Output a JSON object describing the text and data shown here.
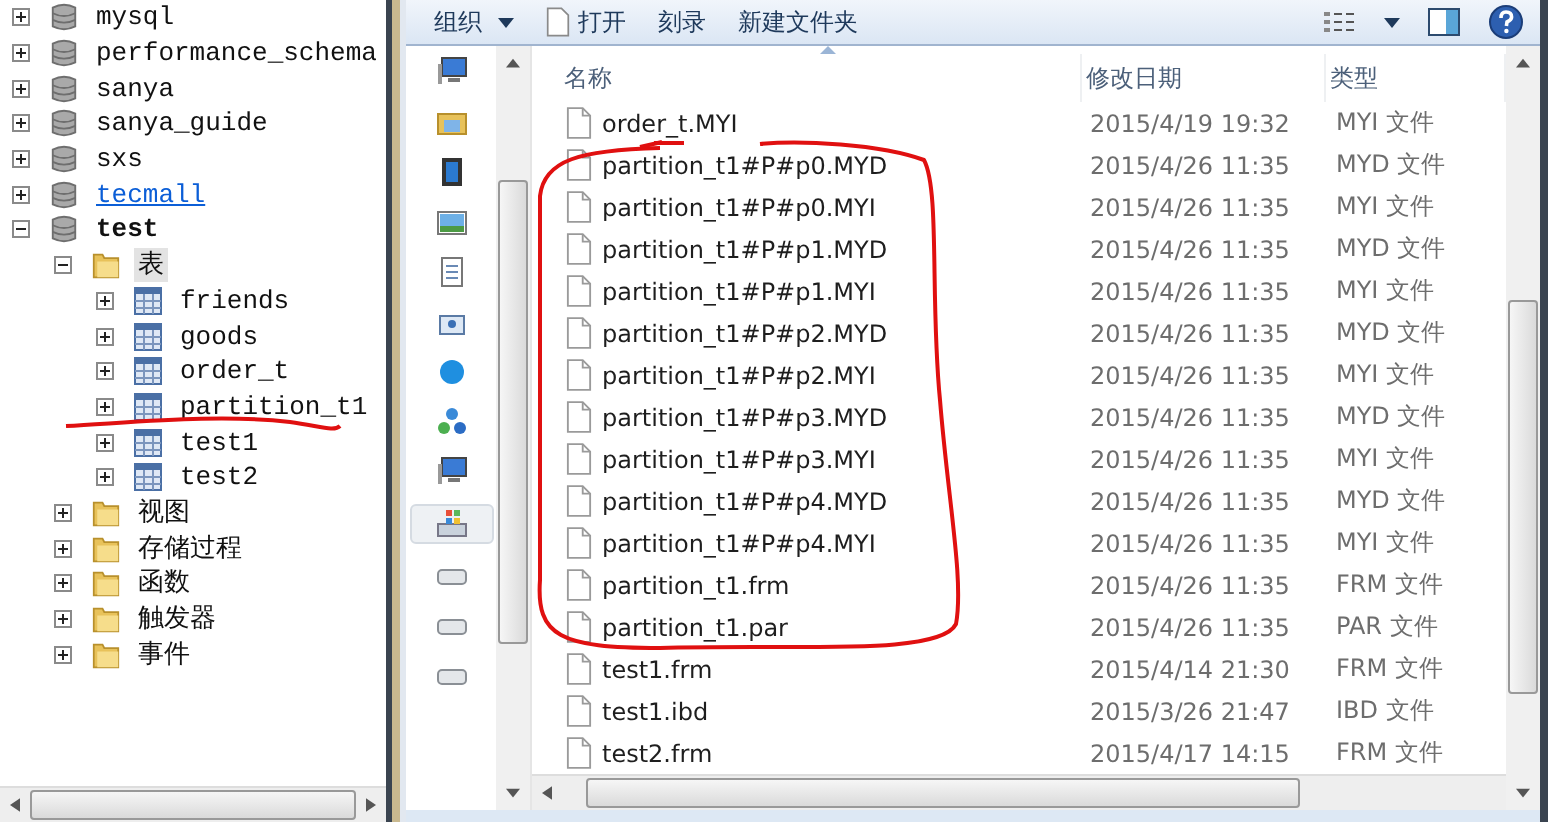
{
  "tree": {
    "items": [
      {
        "label": "mysql",
        "kind": "database",
        "expanded": false,
        "selected": false,
        "hovered": false,
        "active": false
      },
      {
        "label": "performance_schema",
        "kind": "database",
        "expanded": false,
        "selected": false,
        "hovered": false,
        "active": false
      },
      {
        "label": "sanya",
        "kind": "database",
        "expanded": false,
        "selected": false,
        "hovered": false,
        "active": false
      },
      {
        "label": "sanya_guide",
        "kind": "database",
        "expanded": false,
        "selected": false,
        "hovered": false,
        "active": false
      },
      {
        "label": "sxs",
        "kind": "database",
        "expanded": false,
        "selected": false,
        "hovered": false,
        "active": false
      },
      {
        "label": "tecmall",
        "kind": "database",
        "expanded": false,
        "selected": false,
        "hovered": true,
        "active": false
      },
      {
        "label": "test",
        "kind": "database",
        "expanded": true,
        "selected": false,
        "hovered": false,
        "active": true,
        "children": [
          {
            "label": "表",
            "kind": "folder",
            "expanded": true,
            "selected": true,
            "hovered": false,
            "active": false,
            "children": [
              {
                "label": "friends",
                "kind": "table",
                "expanded": false,
                "selected": false,
                "hovered": false,
                "active": false
              },
              {
                "label": "goods",
                "kind": "table",
                "expanded": false,
                "selected": false,
                "hovered": false,
                "active": false
              },
              {
                "label": "order_t",
                "kind": "table",
                "expanded": false,
                "selected": false,
                "hovered": false,
                "active": false
              },
              {
                "label": "partition_t1",
                "kind": "table",
                "expanded": false,
                "selected": false,
                "hovered": false,
                "active": false
              },
              {
                "label": "test1",
                "kind": "table",
                "expanded": false,
                "selected": false,
                "hovered": false,
                "active": false
              },
              {
                "label": "test2",
                "kind": "table",
                "expanded": false,
                "selected": false,
                "hovered": false,
                "active": false
              }
            ]
          },
          {
            "label": "视图",
            "kind": "folder",
            "expanded": false,
            "selected": false,
            "hovered": false,
            "active": false
          },
          {
            "label": "存储过程",
            "kind": "folder",
            "expanded": false,
            "selected": false,
            "hovered": false,
            "active": false
          },
          {
            "label": "函数",
            "kind": "folder",
            "expanded": false,
            "selected": false,
            "hovered": false,
            "active": false
          },
          {
            "label": "触发器",
            "kind": "folder",
            "expanded": false,
            "selected": false,
            "hovered": false,
            "active": false
          },
          {
            "label": "事件",
            "kind": "folder",
            "expanded": false,
            "selected": false,
            "hovered": false,
            "active": false
          }
        ]
      }
    ]
  },
  "explorer": {
    "toolbar": {
      "buttons": [
        {
          "label": "组织",
          "kind": "menu"
        },
        {
          "label": "打开",
          "kind": "open"
        },
        {
          "label": "刻录",
          "kind": "plain"
        },
        {
          "label": "新建文件夹",
          "kind": "plain"
        }
      ]
    },
    "nav_pane": {
      "items": [
        {
          "kind": "computer",
          "selected": false
        },
        {
          "kind": "library",
          "selected": false
        },
        {
          "kind": "video",
          "selected": false
        },
        {
          "kind": "picture",
          "selected": false
        },
        {
          "kind": "document",
          "selected": false
        },
        {
          "kind": "music",
          "selected": false
        },
        {
          "kind": "homegroup",
          "selected": false
        },
        {
          "kind": "network",
          "selected": false
        },
        {
          "kind": "computer",
          "selected": false
        },
        {
          "kind": "windows-drive",
          "selected": true
        },
        {
          "kind": "drive",
          "selected": false
        },
        {
          "kind": "drive",
          "selected": false
        },
        {
          "kind": "drive",
          "selected": false
        }
      ]
    },
    "file_list": {
      "columns": [
        {
          "label": "名称",
          "sorted": true
        },
        {
          "label": "修改日期",
          "sorted": false
        },
        {
          "label": "类型",
          "sorted": false
        }
      ],
      "rows": [
        {
          "name": "order_t.MYI",
          "modified": "2015/4/19 19:32",
          "type": "MYI 文件"
        },
        {
          "name": "partition_t1#P#p0.MYD",
          "modified": "2015/4/26 11:35",
          "type": "MYD 文件"
        },
        {
          "name": "partition_t1#P#p0.MYI",
          "modified": "2015/4/26 11:35",
          "type": "MYI 文件"
        },
        {
          "name": "partition_t1#P#p1.MYD",
          "modified": "2015/4/26 11:35",
          "type": "MYD 文件"
        },
        {
          "name": "partition_t1#P#p1.MYI",
          "modified": "2015/4/26 11:35",
          "type": "MYI 文件"
        },
        {
          "name": "partition_t1#P#p2.MYD",
          "modified": "2015/4/26 11:35",
          "type": "MYD 文件"
        },
        {
          "name": "partition_t1#P#p2.MYI",
          "modified": "2015/4/26 11:35",
          "type": "MYI 文件"
        },
        {
          "name": "partition_t1#P#p3.MYD",
          "modified": "2015/4/26 11:35",
          "type": "MYD 文件"
        },
        {
          "name": "partition_t1#P#p3.MYI",
          "modified": "2015/4/26 11:35",
          "type": "MYI 文件"
        },
        {
          "name": "partition_t1#P#p4.MYD",
          "modified": "2015/4/26 11:35",
          "type": "MYD 文件"
        },
        {
          "name": "partition_t1#P#p4.MYI",
          "modified": "2015/4/26 11:35",
          "type": "MYI 文件"
        },
        {
          "name": "partition_t1.frm",
          "modified": "2015/4/26 11:35",
          "type": "FRM 文件"
        },
        {
          "name": "partition_t1.par",
          "modified": "2015/4/26 11:35",
          "type": "PAR 文件"
        },
        {
          "name": "test1.frm",
          "modified": "2015/4/14 21:30",
          "type": "FRM 文件"
        },
        {
          "name": "test1.ibd",
          "modified": "2015/3/26 21:47",
          "type": "IBD 文件"
        },
        {
          "name": "test2.frm",
          "modified": "2015/4/17 14:15",
          "type": "FRM 文件"
        }
      ]
    }
  }
}
